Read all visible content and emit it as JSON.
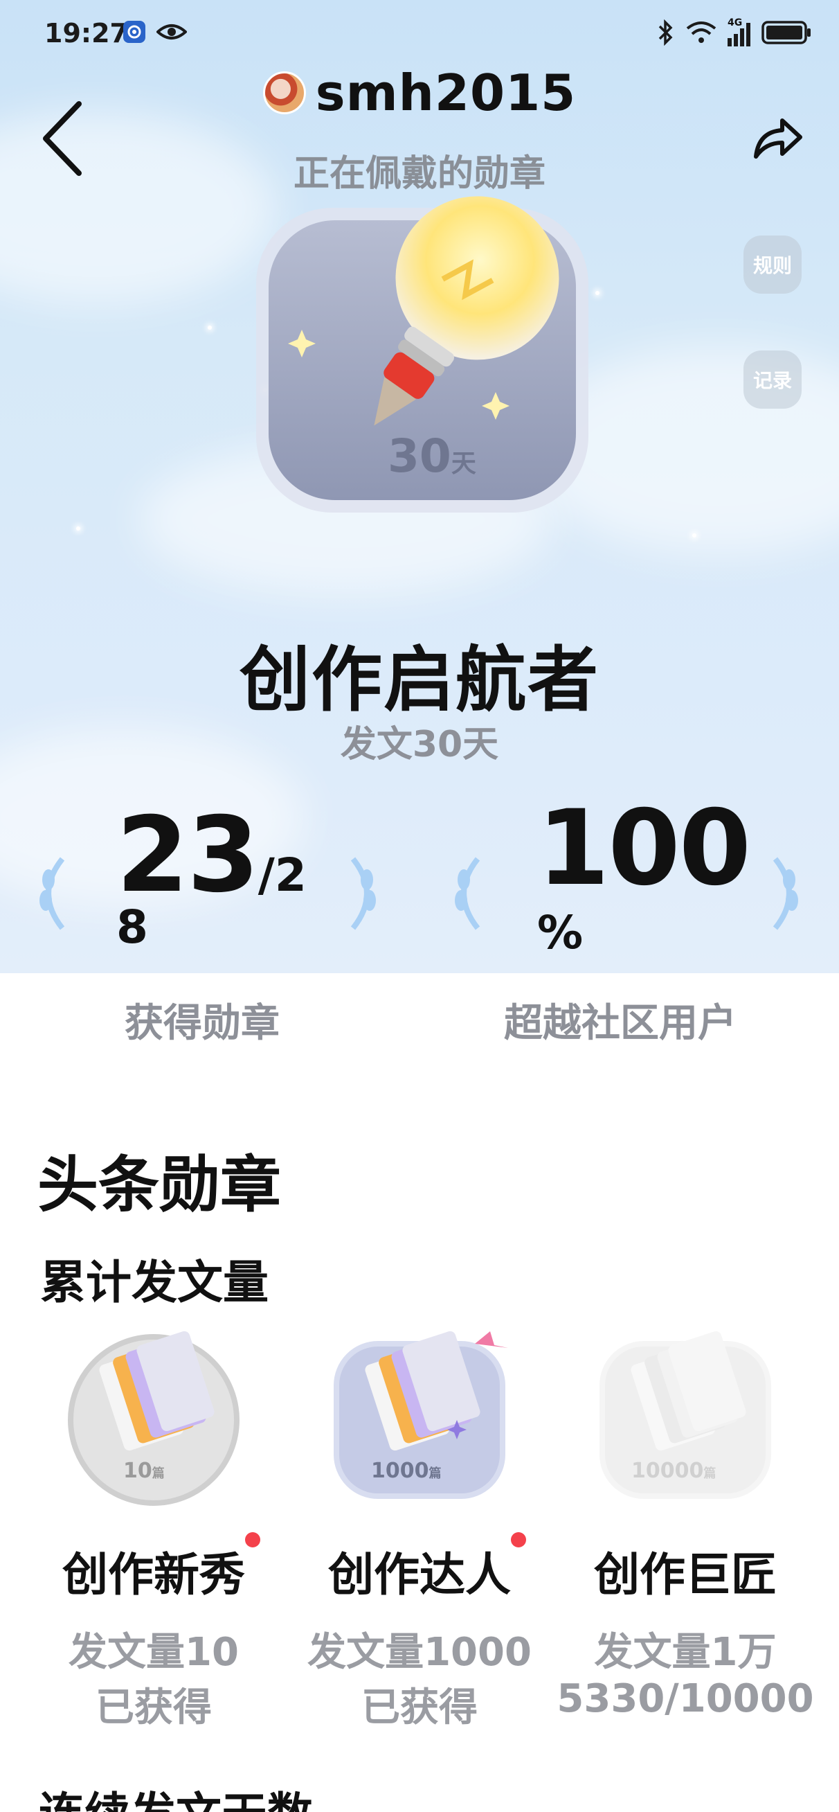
{
  "status_bar": {
    "time": "19:27",
    "network": "4G"
  },
  "header": {
    "username": "smh2015",
    "wearing_label": "正在佩戴的勋章",
    "rules_label": "规则",
    "records_label": "记录"
  },
  "main_badge": {
    "days_number": "30",
    "days_unit": "天",
    "title": "创作启航者",
    "subtitle": "发文30天"
  },
  "stats": {
    "earned_value": "23",
    "earned_total_part1": "/2",
    "earned_total_part2": "8",
    "earned_label": "获得勋章",
    "surpass_value": "100",
    "surpass_unit": "%",
    "surpass_label": "超越社区用户"
  },
  "section": {
    "title": "头条勋章",
    "category_title": "累计发文量",
    "next_category_title": "连续发文天数"
  },
  "badges": [
    {
      "number": "10",
      "unit": "篇",
      "name": "创作新秀",
      "desc": "发文量10",
      "status": "已获得",
      "has_dot": true
    },
    {
      "number": "1000",
      "unit": "篇",
      "name": "创作达人",
      "desc": "发文量1000",
      "status": "已获得",
      "has_dot": true
    },
    {
      "number": "10000",
      "unit": "篇",
      "name": "创作巨匠",
      "desc": "发文量1万",
      "status": "5330/10000",
      "has_dot": false
    }
  ],
  "colors": {
    "accent_red": "#f4414b",
    "muted_text": "#8d9098",
    "hero_bg": "#d6e9f8"
  },
  "icons": {
    "back": "chevron-left-icon",
    "share": "share-arrow-icon",
    "bluetooth": "bluetooth-icon",
    "wifi": "wifi-icon",
    "signal": "signal-icon",
    "battery": "battery-icon",
    "shield": "shield-app-icon",
    "eye": "eye-icon"
  }
}
